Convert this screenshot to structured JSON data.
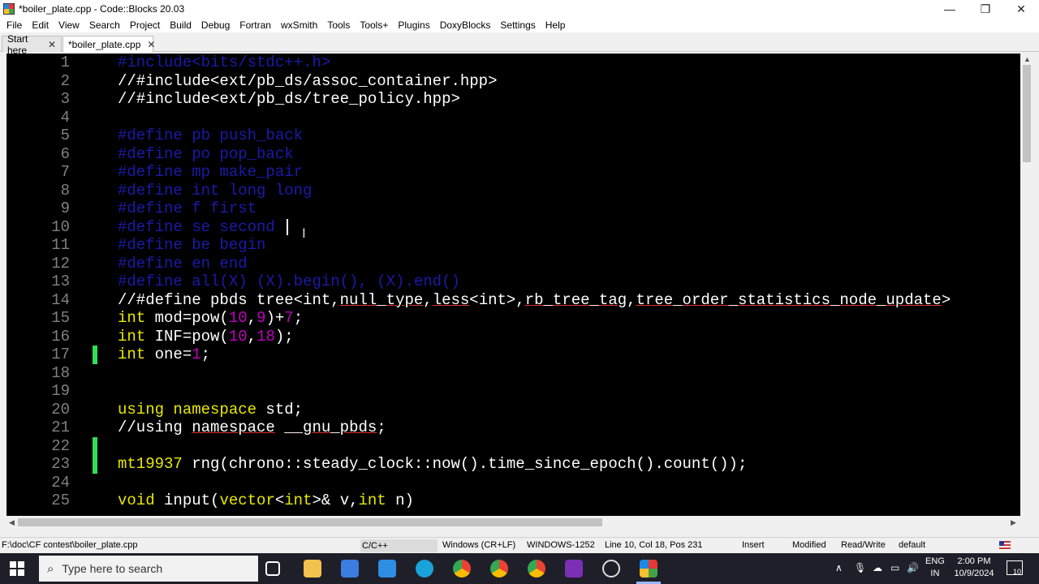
{
  "window": {
    "title": "*boiler_plate.cpp - Code::Blocks 20.03",
    "minimize": "—",
    "maximize": "❐",
    "close": "✕"
  },
  "menu": [
    "File",
    "Edit",
    "View",
    "Search",
    "Project",
    "Build",
    "Debug",
    "Fortran",
    "wxSmith",
    "Tools",
    "Tools+",
    "Plugins",
    "DoxyBlocks",
    "Settings",
    "Help"
  ],
  "tabs": [
    {
      "label": "Start here",
      "close": "✕"
    },
    {
      "label": "*boiler_plate.cpp",
      "close": "✕"
    }
  ],
  "editor": {
    "lines": [
      {
        "n": "1",
        "marker": false,
        "tokens": [
          [
            "pre",
            "#include<bits/stdc++.h>"
          ]
        ]
      },
      {
        "n": "2",
        "marker": false,
        "tokens": [
          [
            "cmt",
            "//#include<ext/pb_ds/assoc_container.hpp>"
          ]
        ]
      },
      {
        "n": "3",
        "marker": false,
        "tokens": [
          [
            "cmt",
            "//#include<ext/pb_ds/tree_policy.hpp>"
          ]
        ]
      },
      {
        "n": "4",
        "marker": false,
        "tokens": []
      },
      {
        "n": "5",
        "marker": false,
        "tokens": [
          [
            "pre",
            "#define pb push_back"
          ]
        ]
      },
      {
        "n": "6",
        "marker": false,
        "tokens": [
          [
            "pre",
            "#define po pop_back"
          ]
        ]
      },
      {
        "n": "7",
        "marker": false,
        "tokens": [
          [
            "pre",
            "#define mp make_pair"
          ]
        ]
      },
      {
        "n": "8",
        "marker": false,
        "tokens": [
          [
            "pre",
            "#define int long long"
          ]
        ]
      },
      {
        "n": "9",
        "marker": false,
        "tokens": [
          [
            "pre",
            "#define f first"
          ]
        ]
      },
      {
        "n": "10",
        "marker": false,
        "tokens": [
          [
            "pre",
            "#define se second"
          ]
        ]
      },
      {
        "n": "11",
        "marker": false,
        "tokens": [
          [
            "pre",
            "#define be begin"
          ]
        ]
      },
      {
        "n": "12",
        "marker": false,
        "tokens": [
          [
            "pre",
            "#define en end"
          ]
        ]
      },
      {
        "n": "13",
        "marker": false,
        "tokens": [
          [
            "pre",
            "#define all(X) (X).begin(), (X).end()"
          ]
        ]
      },
      {
        "n": "14",
        "marker": false,
        "tokens": [
          [
            "cmt",
            "//#define pbds tree<int,"
          ],
          [
            "cmtu",
            "null_type"
          ],
          [
            "cmt",
            ","
          ],
          [
            "cmtu",
            "less"
          ],
          [
            "cmt",
            "<int>,"
          ],
          [
            "cmtu",
            "rb_tree_tag"
          ],
          [
            "cmt",
            ","
          ],
          [
            "cmtu",
            "tree_order_statistics_node_update"
          ],
          [
            "cmt",
            ">"
          ]
        ]
      },
      {
        "n": "15",
        "marker": false,
        "tokens": [
          [
            "kw",
            "int"
          ],
          [
            "txt",
            " mod=pow("
          ],
          [
            "num",
            "10"
          ],
          [
            "txt",
            ","
          ],
          [
            "num",
            "9"
          ],
          [
            "txt",
            ")+"
          ],
          [
            "num",
            "7"
          ],
          [
            "txt",
            ";"
          ]
        ]
      },
      {
        "n": "16",
        "marker": false,
        "tokens": [
          [
            "kw",
            "int"
          ],
          [
            "txt",
            " INF=pow("
          ],
          [
            "num",
            "10"
          ],
          [
            "txt",
            ","
          ],
          [
            "num",
            "18"
          ],
          [
            "txt",
            ");"
          ]
        ]
      },
      {
        "n": "17",
        "marker": true,
        "tokens": [
          [
            "kw",
            "int"
          ],
          [
            "txt",
            " one="
          ],
          [
            "num",
            "1"
          ],
          [
            "txt",
            ";"
          ]
        ]
      },
      {
        "n": "18",
        "marker": false,
        "tokens": []
      },
      {
        "n": "19",
        "marker": false,
        "tokens": []
      },
      {
        "n": "20",
        "marker": false,
        "tokens": [
          [
            "kw",
            "using namespace"
          ],
          [
            "txt",
            " std;"
          ]
        ]
      },
      {
        "n": "21",
        "marker": false,
        "tokens": [
          [
            "cmt",
            "//using "
          ],
          [
            "cmtu",
            "namespace"
          ],
          [
            "cmt",
            " "
          ],
          [
            "cmtu",
            "__gnu_pbds"
          ],
          [
            "cmt",
            ";"
          ]
        ]
      },
      {
        "n": "22",
        "marker": true,
        "tokens": []
      },
      {
        "n": "23",
        "marker": true,
        "tokens": [
          [
            "kw",
            "mt19937"
          ],
          [
            "txt",
            " rng(chrono::steady_clock::now().time_since_epoch().count());"
          ]
        ]
      },
      {
        "n": "24",
        "marker": false,
        "tokens": []
      },
      {
        "n": "25",
        "marker": false,
        "tokens": [
          [
            "kw",
            "void"
          ],
          [
            "txt",
            " input("
          ],
          [
            "kw",
            "vector"
          ],
          [
            "txt",
            "<"
          ],
          [
            "kw",
            "int"
          ],
          [
            "txt",
            ">& v,"
          ],
          [
            "kw",
            "int"
          ],
          [
            "txt",
            " n)"
          ]
        ]
      }
    ]
  },
  "status": {
    "path": "F:\\doc\\CF contest\\boiler_plate.cpp",
    "language": "C/C++",
    "eol": "Windows (CR+LF)",
    "encoding": "WINDOWS-1252",
    "position": "Line 10, Col 18, Pos 231",
    "mode": "Insert",
    "modified": "Modified",
    "access": "Read/Write",
    "profile": "default"
  },
  "taskbar": {
    "search_placeholder": "Type here to search",
    "lang_top": "ENG",
    "lang_bottom": "IN",
    "time": "2:00 PM",
    "date": "10/9/2024",
    "notifications": "10"
  },
  "colors": {
    "editor_bg": "#000000",
    "comment": "#ffffff",
    "preprocessor": "#1a1aa8",
    "keyword": "#e8e800",
    "number": "#c000c0",
    "change_marker": "#33dd55"
  }
}
